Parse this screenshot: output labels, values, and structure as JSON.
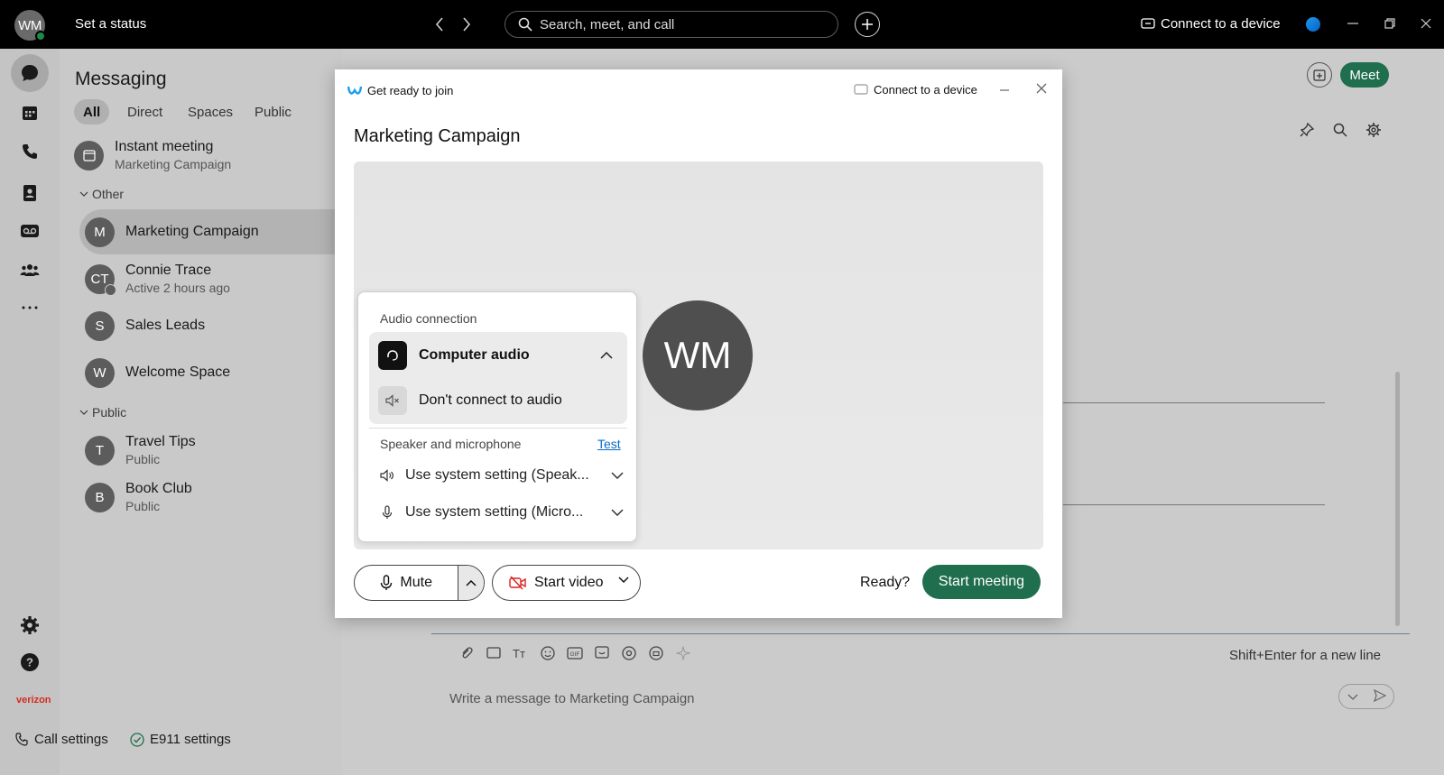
{
  "titlebar": {
    "avatar_initials": "WM",
    "status_label": "Set a status",
    "search_placeholder": "Search, meet, and call",
    "connect_label": "Connect to a device"
  },
  "messaging": {
    "title": "Messaging",
    "filters": [
      "All",
      "Direct",
      "Spaces",
      "Public"
    ],
    "active_filter": "All",
    "instant_meeting": {
      "title": "Instant meeting",
      "subtitle": "Marketing Campaign"
    },
    "sections": {
      "other": "Other",
      "public": "Public"
    },
    "conversations": [
      {
        "initial": "M",
        "name": "Marketing Campaign",
        "subtitle": ""
      },
      {
        "initial": "CT",
        "name": "Connie Trace",
        "subtitle": "Active 2 hours ago"
      },
      {
        "initial": "S",
        "name": "Sales Leads",
        "subtitle": ""
      },
      {
        "initial": "W",
        "name": "Welcome Space",
        "subtitle": ""
      }
    ],
    "public_conversations": [
      {
        "initial": "T",
        "name": "Travel Tips",
        "subtitle": "Public"
      },
      {
        "initial": "B",
        "name": "Book Club",
        "subtitle": "Public"
      }
    ]
  },
  "header": {
    "meet_label": "Meet"
  },
  "compose": {
    "hint": "Shift+Enter for a new line",
    "placeholder": "Write a message to Marketing Campaign"
  },
  "bottom": {
    "call_settings": "Call settings",
    "e911_settings": "E911 settings",
    "brand": "verizon"
  },
  "modal": {
    "header_label": "Get ready to join",
    "connect_label": "Connect to a device",
    "meeting_title": "Marketing Campaign",
    "avatar_initials": "WM",
    "audio": {
      "section_label": "Audio connection",
      "selected": "Computer audio",
      "alternative": "Don't connect to audio",
      "speaker_mic_label": "Speaker and microphone",
      "test_label": "Test",
      "speaker_value": "Use system setting (Speak...",
      "mic_value": "Use system setting (Micro..."
    },
    "mute_label": "Mute",
    "video_label": "Start video",
    "ready_label": "Ready?",
    "start_label": "Start meeting"
  },
  "colors": {
    "accent_green": "#1f6e4e",
    "link_blue": "#0b6bc4",
    "verizon_red": "#d52b1e"
  }
}
